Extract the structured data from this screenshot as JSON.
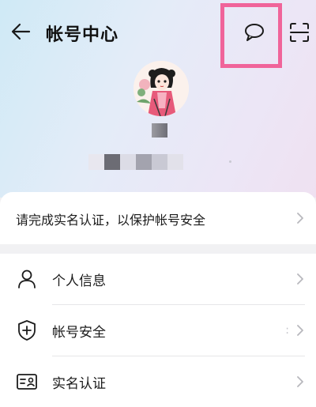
{
  "header": {
    "title": "帐号中心",
    "back_icon": "arrow-left-icon",
    "chat_icon": "chat-bubble-icon",
    "scan_icon": "scan-icon",
    "highlight_color": "#f0649a"
  },
  "profile": {
    "avatar_icon": "avatar-illustration"
  },
  "banner": {
    "text": "请完成实名认证，以保护帐号安全"
  },
  "menu": {
    "items": [
      {
        "label": "个人信息",
        "icon": "person-icon"
      },
      {
        "label": "帐号安全",
        "icon": "shield-plus-icon",
        "extra": ":"
      },
      {
        "label": "实名认证",
        "icon": "id-card-icon"
      }
    ]
  }
}
